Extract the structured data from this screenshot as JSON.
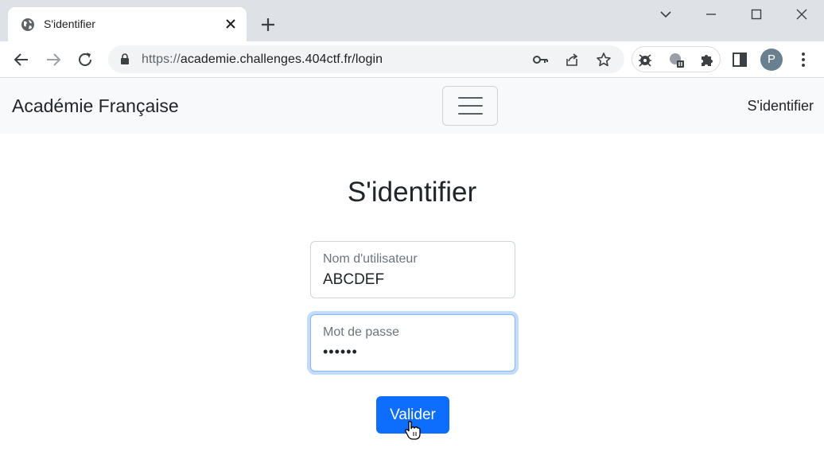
{
  "browser": {
    "tab": {
      "title": "S'identifier",
      "favicon": "globe-icon"
    },
    "address": {
      "scheme": "https://",
      "host_path": "academie.challenges.404ctf.fr/login"
    },
    "profile_initial": "P"
  },
  "navbar": {
    "brand": "Académie Française",
    "login_link": "S'identifier"
  },
  "login": {
    "title": "S'identifier",
    "username": {
      "label": "Nom d'utilisateur",
      "value": "ABCDEF"
    },
    "password": {
      "label": "Mot de passe",
      "value": "••••••"
    },
    "submit_label": "Valider"
  },
  "colors": {
    "primary": "#0d6efd",
    "navbar_bg": "#f8f9fa",
    "focus_ring": "#86b7fe",
    "tabstrip_bg": "#dee1e6"
  }
}
